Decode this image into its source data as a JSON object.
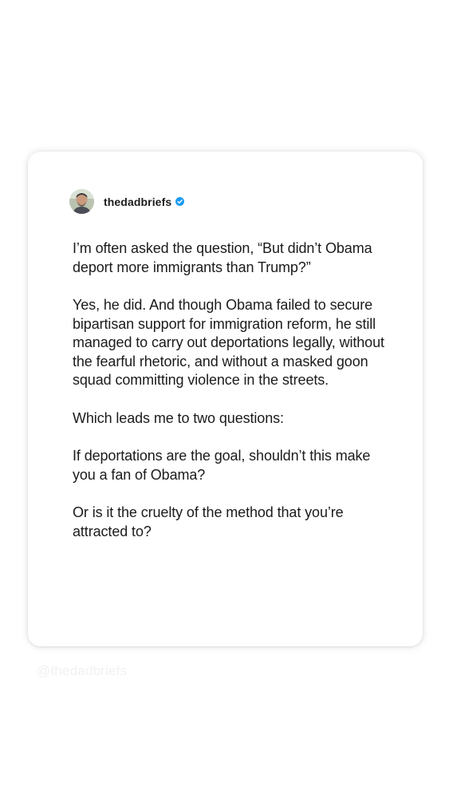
{
  "post": {
    "username": "thedadbriefs",
    "verified_icon": "verified-badge-icon",
    "avatar_icon": "profile-photo",
    "paragraphs": [
      "I’m often asked the question, “But didn’t Obama deport more immigrants than Trump?”",
      "Yes, he did. And though Obama failed to secure bipartisan support for immigration reform, he still managed to carry out deportations legally, without the fearful rhetoric, and without a masked goon squad committing violence in the streets.",
      "Which leads me to two questions:",
      "If deportations are the goal, shouldn’t this make you a fan of Obama?",
      "Or is it the cruelty of the method that you’re attracted to?"
    ]
  },
  "watermark": "@thedadbriefs",
  "colors": {
    "verified_blue": "#1d9bf0",
    "text": "#1b1b1b",
    "card_background": "#ffffff"
  }
}
